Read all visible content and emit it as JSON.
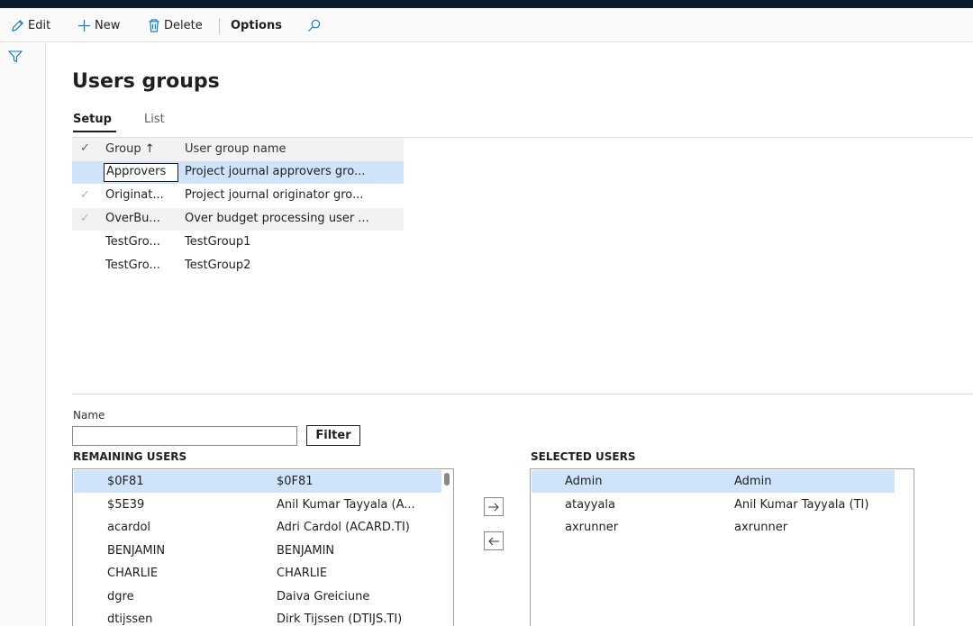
{
  "toolbar": {
    "edit_label": "Edit",
    "new_label": "New",
    "delete_label": "Delete",
    "options_label": "Options",
    "search_icon": "search-icon"
  },
  "page": {
    "title": "Users groups",
    "tabs": [
      {
        "label": "Setup",
        "active": true
      },
      {
        "label": "List",
        "active": false
      }
    ]
  },
  "groups_grid": {
    "columns": [
      "Group ↑",
      "User group name"
    ],
    "rows": [
      {
        "group": "Approvers",
        "name": "Project journal approvers gro...",
        "state": "selected"
      },
      {
        "group": "Originat...",
        "name": "Project journal originator gro...",
        "state": "checked"
      },
      {
        "group": "OverBu...",
        "name": "Over budget processing user ...",
        "state": "checked"
      },
      {
        "group": "TestGro...",
        "name": "TestGroup1",
        "state": "none"
      },
      {
        "group": "TestGro...",
        "name": "TestGroup2",
        "state": "none"
      }
    ]
  },
  "filter": {
    "name_label": "Name",
    "name_value": "",
    "filter_button": "Filter"
  },
  "remaining_users": {
    "title": "REMAINING USERS",
    "rows": [
      {
        "id": "$0F81",
        "name": "$0F81"
      },
      {
        "id": "$5E39",
        "name": "Anil Kumar Tayyala (A..."
      },
      {
        "id": "acardol",
        "name": "Adri Cardol (ACARD.TI)"
      },
      {
        "id": "BENJAMIN",
        "name": "BENJAMIN"
      },
      {
        "id": "CHARLIE",
        "name": "CHARLIE"
      },
      {
        "id": "dgre",
        "name": "Daiva Greiciune"
      },
      {
        "id": "dtijssen",
        "name": "Dirk Tijssen (DTIJS.TI)"
      }
    ]
  },
  "selected_users": {
    "title": "SELECTED USERS",
    "rows": [
      {
        "id": "Admin",
        "name": "Admin"
      },
      {
        "id": "atayyala",
        "name": "Anil Kumar Tayyala (TI)"
      },
      {
        "id": "axrunner",
        "name": "axrunner"
      }
    ]
  },
  "colors": {
    "accent": "#0078d4",
    "selection": "#cfe4fa",
    "topbar": "#0d1b2e"
  }
}
